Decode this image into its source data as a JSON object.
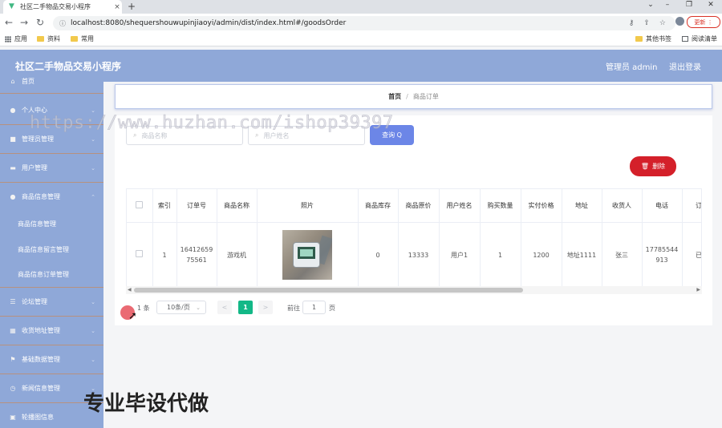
{
  "browser": {
    "tab_title": "社区二手物品交易小程序",
    "tab_close": "×",
    "new_tab": "+",
    "url": "localhost:8080/shequershouwupinjiaoyi/admin/dist/index.html#/goodsOrder",
    "update_label": "更新",
    "bookmarks": [
      "应用",
      "资料",
      "常用"
    ],
    "bookmarks_right": [
      "其他书签",
      "阅读清单"
    ]
  },
  "header": {
    "title": "社区二手物品交易小程序",
    "admin_label": "管理员 admin",
    "logout": "退出登录"
  },
  "sidebar": {
    "items": [
      {
        "label": "首页",
        "icon": "home-icon"
      },
      {
        "label": "个人中心",
        "icon": "user-icon"
      },
      {
        "label": "管理员管理",
        "icon": "briefcase-icon"
      },
      {
        "label": "用户管理",
        "icon": "card-icon"
      },
      {
        "label": "商品信息管理",
        "icon": "user-icon"
      },
      {
        "label": "商品信息管理",
        "icon": ""
      },
      {
        "label": "商品信息留言管理",
        "icon": ""
      },
      {
        "label": "商品信息订单管理",
        "icon": ""
      },
      {
        "label": "论坛管理",
        "icon": "list-icon"
      },
      {
        "label": "收货地址管理",
        "icon": "grid-icon"
      },
      {
        "label": "基础数据管理",
        "icon": "flag-icon"
      },
      {
        "label": "新闻信息管理",
        "icon": "clock-icon"
      },
      {
        "label": "轮播图信息",
        "icon": "picture-icon"
      }
    ]
  },
  "breadcrumb": {
    "home": "首页",
    "separator": "/",
    "current": "商品订单"
  },
  "search": {
    "goods_name_placeholder": "商品名称",
    "user_name_placeholder": "用户姓名",
    "query_label": "查询 Q"
  },
  "actions": {
    "delete_label": "删除"
  },
  "table": {
    "headers": [
      "索引",
      "订单号",
      "商品名称",
      "照片",
      "商品库存",
      "商品原价",
      "用户姓名",
      "购买数量",
      "实付价格",
      "地址",
      "收货人",
      "电话",
      "订单"
    ],
    "rows": [
      {
        "index": "1",
        "order_no": "1641265975561",
        "goods_name": "游戏机",
        "stock": "0",
        "original_price": "13333",
        "user_name": "用户1",
        "quantity": "1",
        "paid_price": "1200",
        "address": "地址1111",
        "receiver": "张三",
        "phone": "17785544913",
        "status": "已发"
      }
    ]
  },
  "pagination": {
    "total": "1 条",
    "page_size": "10条/页",
    "prev": "<",
    "current_page": "1",
    "next": ">",
    "goto_label": "前往",
    "goto_value": "1",
    "page_suffix": "页"
  },
  "overlays": {
    "watermark": "https://www.huzhan.com/ishop39397",
    "promo_text": "专业毕设代做"
  },
  "colors": {
    "theme": "#8fa8d8",
    "query_button": "#6c86e7",
    "delete_button": "#d4202a",
    "active_page": "#13b887"
  }
}
